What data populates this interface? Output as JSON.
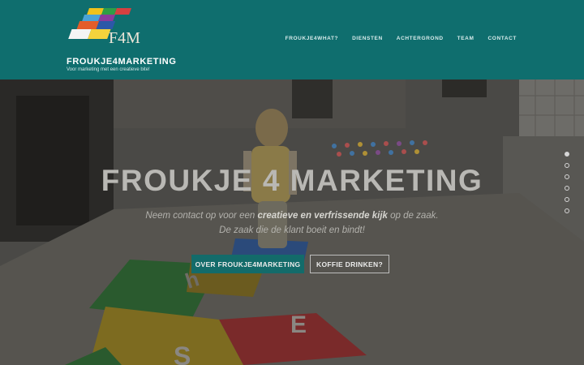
{
  "header": {
    "logo_text": "F4M",
    "title": "FROUKJE4MARKETING",
    "tagline": "Voor marketing met een creatieve bite!"
  },
  "nav": {
    "items": [
      "FROUKJE4WHAT?",
      "DIENSTEN",
      "ACHTERGROND",
      "TEAM",
      "CONTACT"
    ]
  },
  "hero": {
    "title": "FROUKJE 4 MARKETING",
    "line1_pre": "Neem contact op voor een ",
    "line1_bold": "creatieve en verfrissende kijk",
    "line1_post": " op de zaak.",
    "line2": "De zaak die de klant boeit en bindt!",
    "button_primary": "OVER FROUKJE4MARKETING",
    "button_secondary": "KOFFIE DRINKEN?",
    "slides_total": 6,
    "slide_active": 1
  },
  "colors": {
    "header_bg": "#0f6e6e",
    "accent": "#136b6a"
  }
}
